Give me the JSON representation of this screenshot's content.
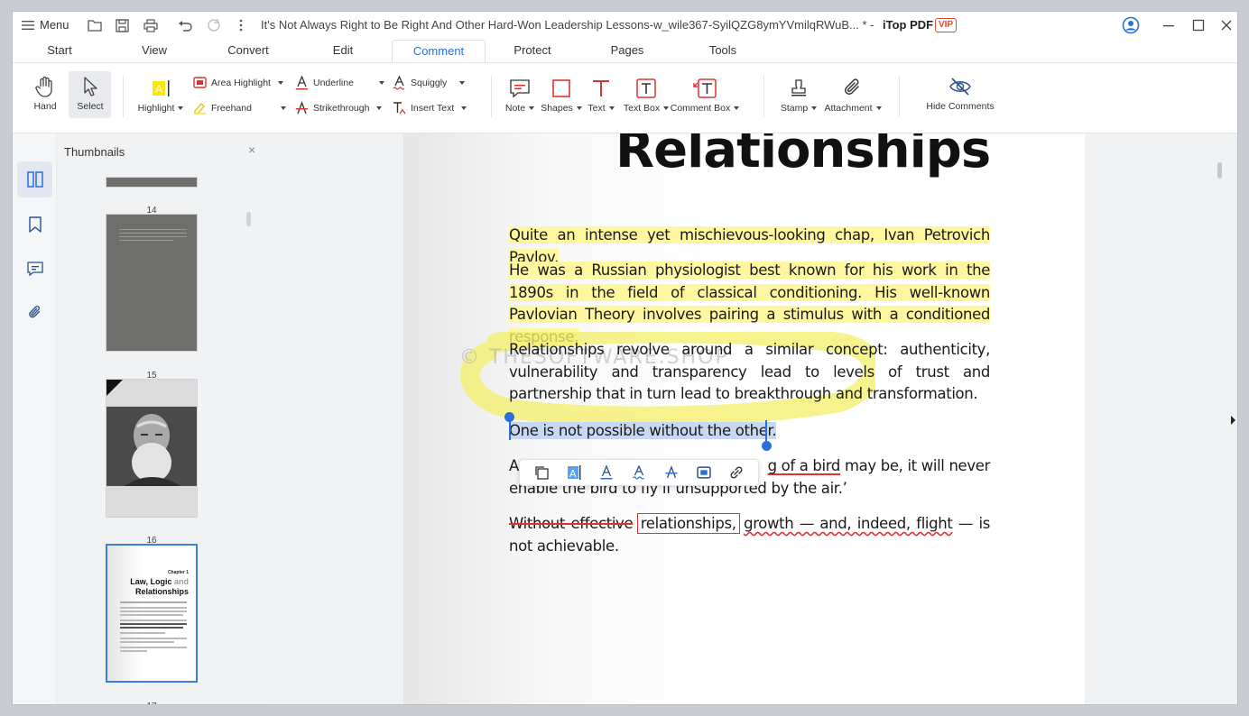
{
  "titlebar": {
    "menu_label": "Menu",
    "doc_title": "It's Not Always Right to Be Right And Other Hard-Won Leadership Lessons-w_wile367-SyilQZG8ymYVmilqRWuB... *",
    "separator": "-",
    "app_name": "iTop PDF",
    "vip_badge": "VIP"
  },
  "tabs": [
    "Start",
    "View",
    "Convert",
    "Edit",
    "Comment",
    "Protect",
    "Pages",
    "Tools"
  ],
  "active_tab": "Comment",
  "toolbar": {
    "hand": "Hand",
    "select": "Select",
    "highlight": "Highlight",
    "area_highlight": "Area Highlight",
    "freehand": "Freehand",
    "underline": "Underline",
    "strikethrough": "Strikethrough",
    "squiggly": "Squiggly",
    "insert_text": "Insert Text",
    "note": "Note",
    "shapes": "Shapes",
    "text": "Text",
    "text_box": "Text Box",
    "comment_box": "Comment Box",
    "stamp": "Stamp",
    "attachment": "Attachment",
    "hide_comments": "Hide Comments"
  },
  "thumbnails": {
    "title": "Thumbnails",
    "close": "×",
    "pages": [
      "14",
      "15",
      "16",
      "17"
    ],
    "page17": {
      "chapter": "Chapter 1",
      "title_line1": "Law, Logic",
      "title_and": "and",
      "title_line2": "Relationships"
    }
  },
  "document": {
    "heading": "Relationships",
    "p1": "Quite an intense yet mischievous-looking chap, Ivan Petrovich Pavlov.",
    "p2": "He was a Russian physiologist best known for his work in the 1890s in the field of classical conditioning. His well-known Pavlovian Theory involves pairing a stimulus with a conditioned response.",
    "p3": "Relationships revolve around a similar concept: authenticity, vulnerability and transparency lead to levels of trust and partnership that in turn lead to breakthrough and transformation.",
    "p4": "One is not possible without the other.",
    "p5_start": "A",
    "p5_underlined": "g of a bird",
    "p5_end": " may be, it will never",
    "p5_line2": "enable the bird to fly if unsupported by the air.’",
    "p6_strike": "Without effective",
    "p6_boxed": "relationships,",
    "p6_wavy": "growth — and, indeed, flight",
    "p6_end": " — is not achievable.",
    "watermark": "© THESOFTWARE.SHOP"
  },
  "colors": {
    "accent": "#2a6fdb",
    "highlight": "#fff7a0",
    "markup_red": "#d33",
    "vip": "#e24b2e"
  }
}
